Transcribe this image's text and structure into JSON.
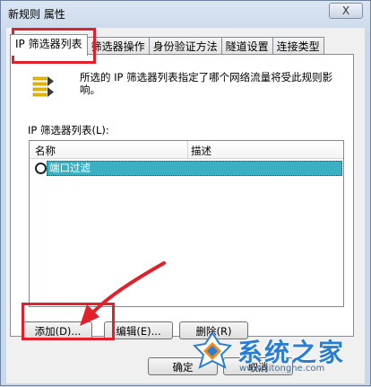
{
  "window": {
    "title": "新规则 属性",
    "close_label": "X"
  },
  "tabs": [
    {
      "label": "IP 筛选器列表",
      "active": true
    },
    {
      "label": "筛选器操作",
      "active": false
    },
    {
      "label": "身份验证方法",
      "active": false
    },
    {
      "label": "隧道设置",
      "active": false
    },
    {
      "label": "连接类型",
      "active": false
    }
  ],
  "panel": {
    "description": "所选的 IP 筛选器列表指定了哪个网络流量将受此规则影响。",
    "list_label": "IP 筛选器列表(L):",
    "columns": {
      "name": "名称",
      "desc": "描述"
    },
    "rows": [
      {
        "name": "端口过滤",
        "desc": "",
        "selected": true
      }
    ]
  },
  "buttons": {
    "add": "添加(D)...",
    "edit": "编辑(E)...",
    "delete": "删除(R)",
    "ok": "确定",
    "cancel": "取消"
  },
  "watermark": {
    "name": "系统之家",
    "url": "www.xitonghe.com"
  },
  "colors": {
    "highlight": "#3ab0c2",
    "annotation": "#e0212b",
    "watermark": "#2a7ed1"
  },
  "icons": {
    "filter_list": "filter-list-icon",
    "close": "close-icon"
  }
}
